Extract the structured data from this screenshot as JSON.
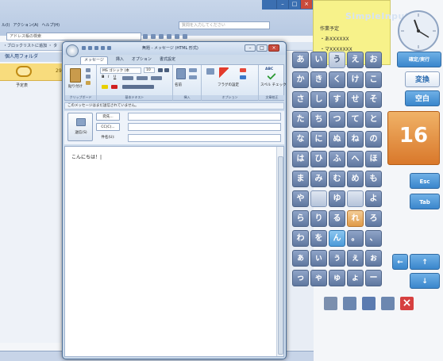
{
  "background_outlook": {
    "menu": [
      "ル(I)",
      "アクション(A)",
      "ヘルプ(H)"
    ],
    "search_placeholder": "質問を入力してください",
    "address_placeholder": "アドレス帳の検索",
    "nav_text": "・ブロックリストに追加 ・ タ",
    "folder_title": "個人用フォルダ",
    "calendar_day": "29",
    "sidebar_label": "予定表",
    "caption_buttons": [
      "–",
      "□",
      "×"
    ]
  },
  "compose": {
    "title": "無題 - メッセージ (HTML 形式)",
    "window_buttons": [
      "–",
      "□",
      "×"
    ],
    "tabs": [
      "メッセージ",
      "挿入",
      "オプション",
      "書式設定"
    ],
    "ribbon": {
      "paste_label": "貼り付け",
      "font_name": "MS ゴシック (本",
      "font_size": "10",
      "names_label": "名前",
      "followup_label": "フラグの設定",
      "spelling_label": "スペル チェック",
      "groups": [
        "クリップボード",
        "基本テキスト",
        "挿入",
        "オプション",
        "文章校正"
      ]
    },
    "info_bar": "このメッセージはまだ送信されていません。",
    "send_label": "送信(S)",
    "to_label": "宛先...",
    "cc_label": "CC(C)...",
    "subject_label": "件名(U):",
    "body_text": "こんにちは！|"
  },
  "simpleinput": {
    "title": "SimpleInput",
    "memo": {
      "title": "作業予定",
      "line1": "・あXXXXXX",
      "line2": "・マXXXXXXX"
    },
    "keys": [
      [
        "あ",
        "い",
        "う",
        "え",
        "お"
      ],
      [
        "か",
        "き",
        "く",
        "け",
        "こ"
      ],
      [
        "さ",
        "し",
        "す",
        "せ",
        "そ"
      ],
      [
        "た",
        "ち",
        "つ",
        "て",
        "と"
      ],
      [
        "な",
        "に",
        "ぬ",
        "ね",
        "の"
      ],
      [
        "は",
        "ひ",
        "ふ",
        "へ",
        "ほ"
      ],
      [
        "ま",
        "み",
        "む",
        "め",
        "も"
      ],
      [
        "や",
        "",
        "ゆ",
        "",
        "よ"
      ],
      [
        "ら",
        "り",
        "る",
        "れ",
        "ろ"
      ],
      [
        "わ",
        "を",
        "ん",
        "。",
        "、"
      ],
      [
        "ぁ",
        "ぃ",
        "ぅ",
        "ぇ",
        "ぉ"
      ],
      [
        "っ",
        "ゃ",
        "ゅ",
        "ょ",
        "ー"
      ]
    ],
    "function_keys": {
      "convert_label": "変換",
      "kuuhaku_label": "空白",
      "date_number": "16",
      "esc_label": "Esc",
      "tab_label": "Tab",
      "enter_label": "確定/実行"
    },
    "accent_color": "#3a86cc"
  }
}
